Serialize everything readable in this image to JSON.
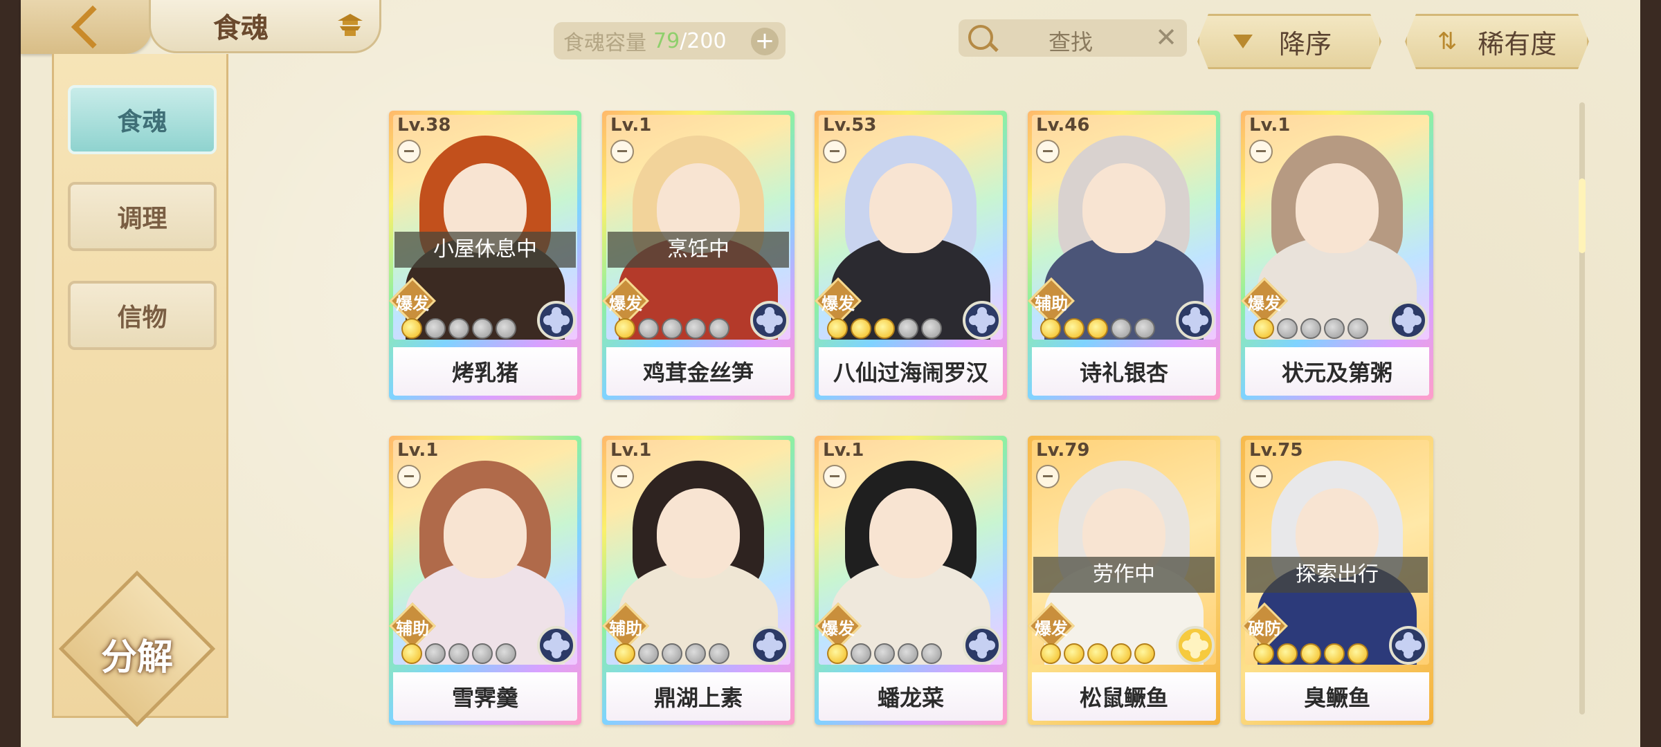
{
  "header": {
    "title": "食魂",
    "capacity_label": "食魂容量",
    "capacity_current": "79",
    "capacity_sep": "/",
    "capacity_max": "200",
    "add_label": "+",
    "search_placeholder": "查找",
    "clear_label": "✕",
    "sort_order_label": "降序",
    "sort_key_label": "稀有度"
  },
  "sidebar": {
    "items": [
      {
        "label": "食魂",
        "active": true
      },
      {
        "label": "调理",
        "active": false
      },
      {
        "label": "信物",
        "active": false
      }
    ],
    "decompose_label": "分解"
  },
  "cards": [
    {
      "level": "Lv.38",
      "name": "烤乳猪",
      "status": "小屋休息中",
      "role": "爆发",
      "stars_on": 1,
      "frame": "rainbow",
      "element": "blue-flower",
      "hair": "#c2501c",
      "outfit": "#3b2a22"
    },
    {
      "level": "Lv.1",
      "name": "鸡茸金丝笋",
      "status": "烹饪中",
      "role": "爆发",
      "stars_on": 1,
      "frame": "rainbow",
      "element": "blue-flower",
      "hair": "#f2d39a",
      "outfit": "#b43a2a"
    },
    {
      "level": "Lv.53",
      "name": "八仙过海闹罗汉",
      "status": "",
      "role": "爆发",
      "stars_on": 3,
      "frame": "rainbow",
      "element": "blue-flower",
      "hair": "#c9d4ef",
      "outfit": "#2b2a30"
    },
    {
      "level": "Lv.46",
      "name": "诗礼银杏",
      "status": "",
      "role": "辅助",
      "stars_on": 3,
      "frame": "rainbow",
      "element": "blue-flower",
      "hair": "#d9d2cf",
      "outfit": "#4b5578"
    },
    {
      "level": "Lv.1",
      "name": "状元及第粥",
      "status": "",
      "role": "爆发",
      "stars_on": 1,
      "frame": "rainbow",
      "element": "blue-flower",
      "hair": "#b69a82",
      "outfit": "#e9e2da"
    },
    {
      "level": "Lv.1",
      "name": "雪霁羹",
      "status": "",
      "role": "辅助",
      "stars_on": 1,
      "frame": "rainbow",
      "element": "blue-flower",
      "hair": "#b06a4a",
      "outfit": "#efe2e8"
    },
    {
      "level": "Lv.1",
      "name": "鼎湖上素",
      "status": "",
      "role": "辅助",
      "stars_on": 1,
      "frame": "rainbow",
      "element": "blue-flower",
      "hair": "#2e2320",
      "outfit": "#efe6d4"
    },
    {
      "level": "Lv.1",
      "name": "蟠龙菜",
      "status": "",
      "role": "爆发",
      "stars_on": 1,
      "frame": "rainbow",
      "element": "blue-flower",
      "hair": "#1f1f1f",
      "outfit": "#efe8dc"
    },
    {
      "level": "Lv.79",
      "name": "松鼠鳜鱼",
      "status": "劳作中",
      "role": "爆发",
      "stars_on": 5,
      "frame": "gold",
      "element": "gold-flower",
      "hair": "#e8e4df",
      "outfit": "#f5f2ea"
    },
    {
      "level": "Lv.75",
      "name": "臭鳜鱼",
      "status": "探索出行",
      "role": "破防",
      "stars_on": 5,
      "frame": "gold",
      "element": "blue-flower",
      "hair": "#e8e8ea",
      "outfit": "#2c3a7a"
    }
  ]
}
